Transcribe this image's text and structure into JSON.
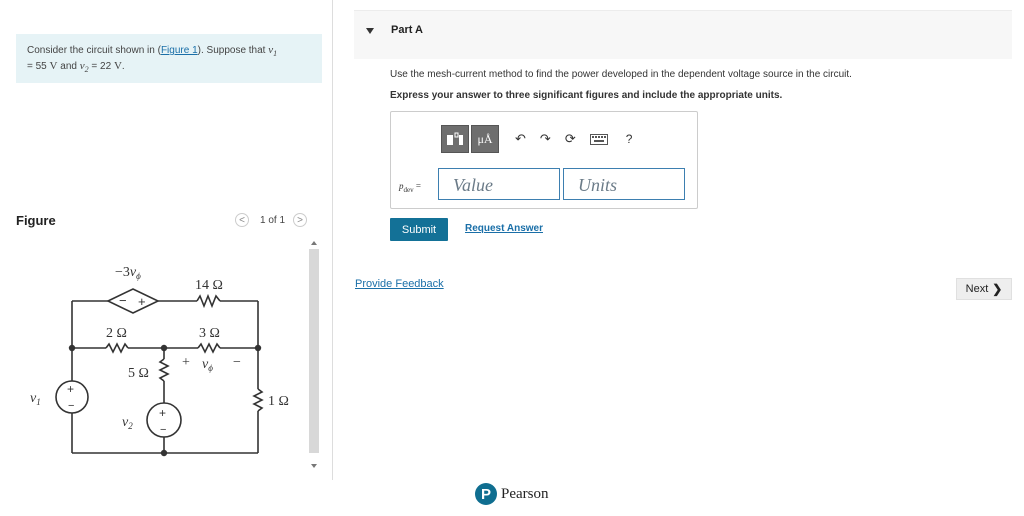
{
  "problem": {
    "text_before": "Consider the circuit shown in (",
    "figure_link": "Figure 1",
    "text_after": "). Suppose that ",
    "v1_symbol": "v",
    "v1_sub": "1",
    "line2_prefix": "= ",
    "v1_value": "55",
    "unit_v": "V",
    "and_text": " and ",
    "v2_symbol": "v",
    "v2_sub": "2",
    "v2_eq": " = ",
    "v2_value": "22",
    "period": "."
  },
  "figure": {
    "label": "Figure",
    "pager": {
      "prev": "<",
      "count": "1 of 1",
      "next": ">"
    }
  },
  "circuit": {
    "dep_source_label": "−3",
    "v_phi": "v",
    "phi": "ϕ",
    "r14": "14 Ω",
    "r2": "2 Ω",
    "r3": "3 Ω",
    "r5": "5 Ω",
    "r1": "1 Ω",
    "v1_label": "v",
    "v1_sub": "1",
    "v2_label": "v",
    "v2_sub": "2",
    "plus": "+",
    "minus": "−"
  },
  "part": {
    "title": "Part A",
    "instruction": "Use the mesh-current method to find the power developed in the dependent voltage source in the circuit.",
    "express": "Express your answer to three significant figures and include the appropriate units."
  },
  "answer": {
    "label_main": "p",
    "label_sub": "dev",
    "label_eq": " =",
    "value_placeholder": "Value",
    "units_placeholder": "Units"
  },
  "toolbar": {
    "templates_icon": "templates-icon",
    "units_label": "μÅ",
    "undo": "↶",
    "redo": "↷",
    "reset": "⟳",
    "keyboard": "keyboard-icon",
    "help": "?"
  },
  "actions": {
    "submit": "Submit",
    "request_answer": "Request Answer",
    "feedback": "Provide Feedback",
    "next": "Next",
    "next_chevron": "❯"
  },
  "brand": {
    "logo_letter": "P",
    "name": "Pearson"
  },
  "colors": {
    "accent": "#137197",
    "link": "#1a6fa8",
    "problem_bg": "#e6f3f6"
  }
}
